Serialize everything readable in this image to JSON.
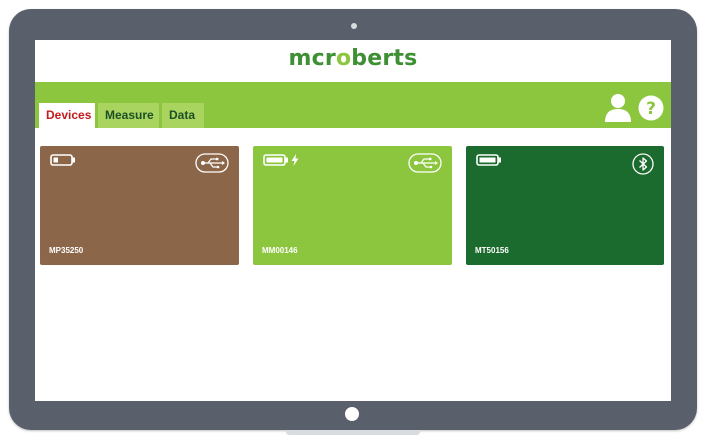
{
  "brand": {
    "logo_prefix": "mcr",
    "logo_o": "o",
    "logo_suffix": "berts",
    "color_primary": "#3f8f35",
    "color_accent": "#8cc63f"
  },
  "tabs": [
    {
      "label": "Devices",
      "active": true
    },
    {
      "label": "Measure",
      "active": false
    },
    {
      "label": "Data",
      "active": false
    }
  ],
  "header_icons": [
    "user-icon",
    "help-icon"
  ],
  "devices": [
    {
      "id": "MP35250",
      "battery": "low",
      "charging": false,
      "connection": "usb",
      "color": "#8c6649"
    },
    {
      "id": "MM00146",
      "battery": "full",
      "charging": true,
      "connection": "usb",
      "color": "#8cc63f"
    },
    {
      "id": "MT50156",
      "battery": "full",
      "charging": false,
      "connection": "bluetooth",
      "color": "#1b6a2e"
    }
  ]
}
